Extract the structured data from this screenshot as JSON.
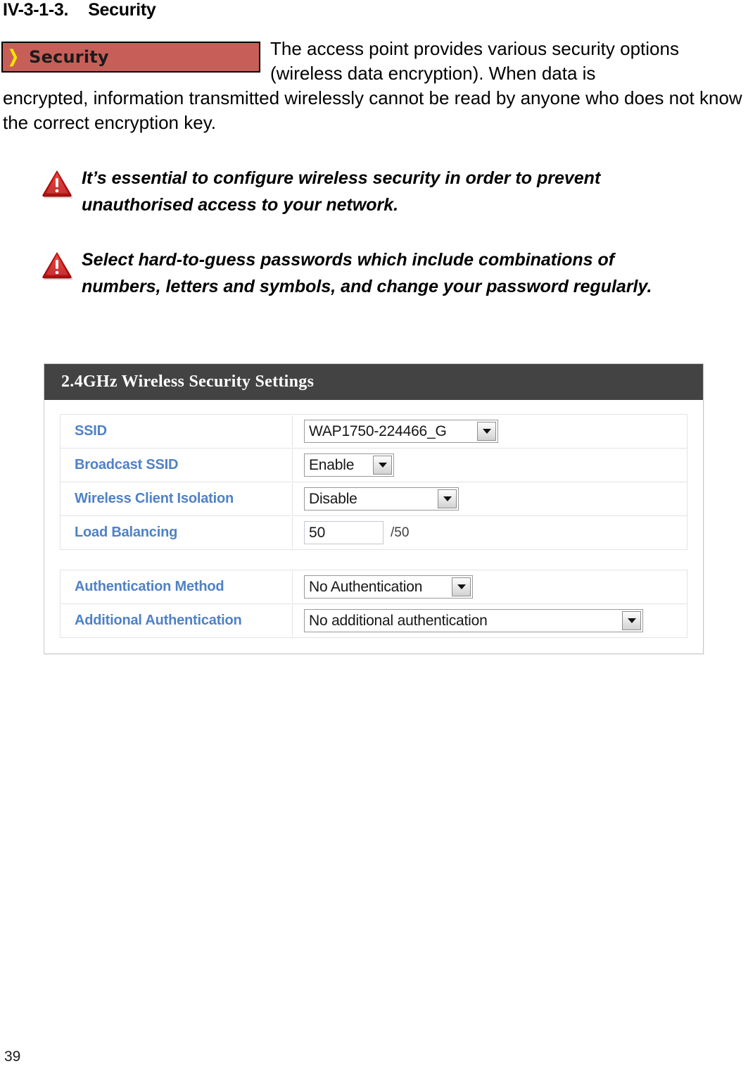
{
  "document": {
    "heading_number": "IV-3-1-3.",
    "heading_title": "Security",
    "page_number": "39"
  },
  "banner": {
    "chevron": "chevron-right",
    "label": "Security",
    "background_color": "#c75f58",
    "chevron_color": "#f2e400",
    "border_color": "#000000"
  },
  "intro": {
    "line_1": "The access point provides various security options",
    "line_2": "(wireless data encryption). When data is",
    "rest": "encrypted, information transmitted wirelessly cannot be read by anyone who does not know the correct encryption key."
  },
  "notes": [
    {
      "icon": "warning-triangle-icon",
      "text": "It’s essential to configure wireless security in order to prevent unauthorised access to your network."
    },
    {
      "icon": "warning-triangle-icon",
      "text": "Select hard-to-guess passwords which include combinations of numbers, letters and symbols, and change your password regularly."
    }
  ],
  "ui_panel": {
    "header_title": "2.4GHz Wireless Security Settings",
    "header_background": "#434343",
    "label_color": "#4f81c7",
    "groups": [
      {
        "rows": [
          {
            "label": "SSID",
            "control": "select",
            "value": "WAP1750-224466_G",
            "width_class": "w-ssid"
          },
          {
            "label": "Broadcast SSID",
            "control": "select",
            "value": "Enable",
            "width_class": "w-enable"
          },
          {
            "label": "Wireless Client Isolation",
            "control": "select",
            "value": "Disable",
            "width_class": "w-disable"
          },
          {
            "label": "Load Balancing",
            "control": "text",
            "value": "50",
            "suffix": "/50"
          }
        ]
      },
      {
        "rows": [
          {
            "label": "Authentication Method",
            "control": "select",
            "value": "No Authentication",
            "width_class": "w-auth"
          },
          {
            "label": "Additional Authentication",
            "control": "select",
            "value": "No additional authentication",
            "width_class": "w-addauth"
          }
        ]
      }
    ]
  }
}
